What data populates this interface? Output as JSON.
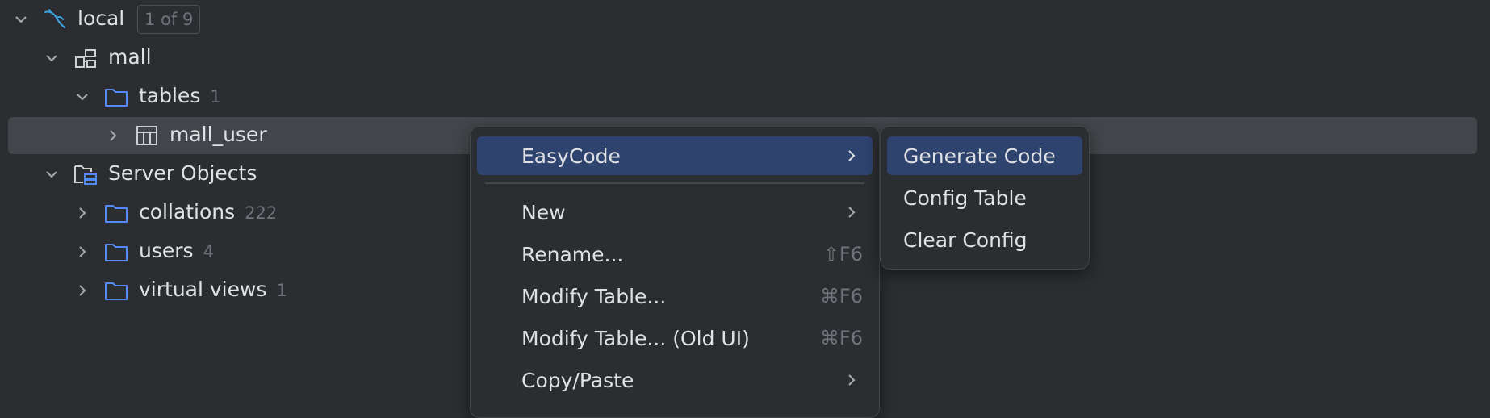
{
  "tree": {
    "local": {
      "label": "local",
      "badge": "1 of 9"
    },
    "mall": {
      "label": "mall"
    },
    "tables": {
      "label": "tables",
      "count": "1"
    },
    "mall_user": {
      "label": "mall_user"
    },
    "server_objects": {
      "label": "Server Objects"
    },
    "collations": {
      "label": "collations",
      "count": "222"
    },
    "users": {
      "label": "users",
      "count": "4"
    },
    "virtual_views": {
      "label": "virtual views",
      "count": "1"
    }
  },
  "context_menu": {
    "easycode": {
      "label": "EasyCode"
    },
    "new": {
      "label": "New"
    },
    "rename": {
      "label": "Rename...",
      "shortcut": "⇧F6"
    },
    "modify_table": {
      "label": "Modify Table...",
      "shortcut": "⌘F6"
    },
    "modify_table_old": {
      "label": "Modify Table... (Old UI)",
      "shortcut": "⌘F6"
    },
    "copy_paste": {
      "label": "Copy/Paste"
    }
  },
  "submenu": {
    "generate_code": {
      "label": "Generate Code"
    },
    "config_table": {
      "label": "Config Table"
    },
    "clear_config": {
      "label": "Clear Config"
    }
  },
  "colors": {
    "background": "#2b2d30",
    "selection": "#43454a",
    "menu_highlight": "#2e436e",
    "folder_icon": "#548af7",
    "datasource_icon": "#3ba3e0",
    "muted_text": "#6f737a"
  }
}
